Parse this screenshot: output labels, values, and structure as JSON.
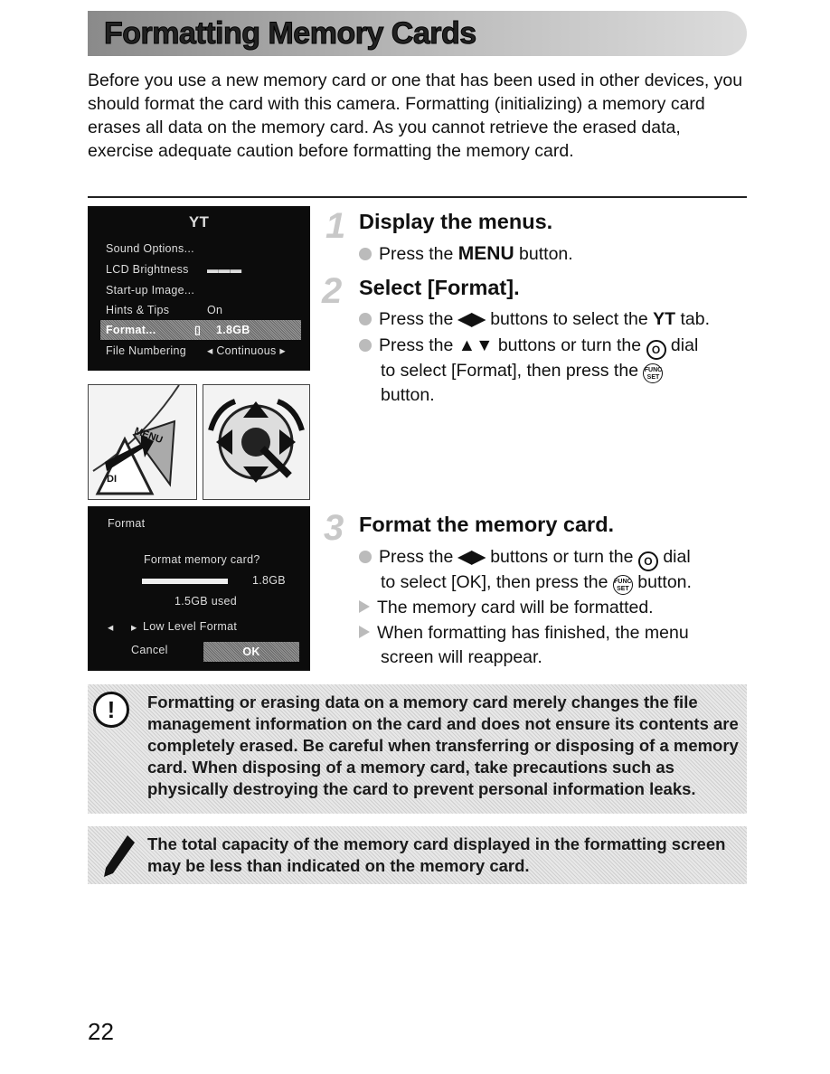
{
  "title": "Formatting Memory Cards",
  "intro": "Before you use a new memory card or one that has been used in other devices, you should format the card with this camera. Formatting (initializing) a memory card erases all data on the memory card. As you cannot retrieve the erased data, exercise adequate caution before formatting the memory card.",
  "screen1": {
    "tab_icon": "ΥT",
    "items": [
      {
        "label": "Sound Options...",
        "value": ""
      },
      {
        "label": "LCD Brightness",
        "value": "▬▬▬"
      },
      {
        "label": "Start-up Image...",
        "value": ""
      },
      {
        "label": "Hints & Tips",
        "value": "On"
      },
      {
        "label": "Format...",
        "value": "1.8GB"
      },
      {
        "label": "File Numbering",
        "value": "◂ Continuous ▸"
      }
    ]
  },
  "illustration": {
    "menu_label": "MENU",
    "disp_label": "DI"
  },
  "screen2": {
    "title": "Format",
    "question": "Format memory card?",
    "capacity": "1.8GB",
    "used": "1.5GB used",
    "low_level": "Low Level Format",
    "cancel": "Cancel",
    "ok": "OK"
  },
  "steps": [
    {
      "num": "1",
      "heading": "Display the menus.",
      "lines": [
        "Press the ",
        "MENU",
        " button."
      ]
    },
    {
      "num": "2",
      "heading": "Select [Format].",
      "line1a": "Press the ",
      "line1arrows": "◀▶",
      "line1b": " buttons to select the ",
      "line1tab": "ΥT",
      "line1c": " tab.",
      "line2a": "Press the ",
      "line2arrows": "▲▼",
      "line2b": " buttons or turn the ",
      "line2c": " dial",
      "line3": "to select [Format], then press the ",
      "line4": "button."
    },
    {
      "num": "3",
      "heading": "Format the memory card.",
      "line1a": "Press the ",
      "line1arrows": "◀▶",
      "line1b": " buttons or turn the ",
      "line1c": " dial",
      "line2a": "to select [OK], then press the ",
      "line2b": " button.",
      "line3": "The memory card will be formatted.",
      "line4": "When formatting has finished, the menu",
      "line5": "screen will reappear."
    }
  ],
  "dial_glyph": "O",
  "func_top": "FUNC",
  "func_bottom": "SET",
  "caution": "Formatting or erasing data on a memory card merely changes the file management information on the card and does not ensure its contents are completely erased. Be careful when transferring or disposing of a memory card. When disposing of a memory card, take precautions such as physically destroying the card to prevent personal information leaks.",
  "caution_icon": "!",
  "note": "The total capacity of the memory card displayed in the formatting screen may be less than indicated on the memory card.",
  "page_number": "22"
}
